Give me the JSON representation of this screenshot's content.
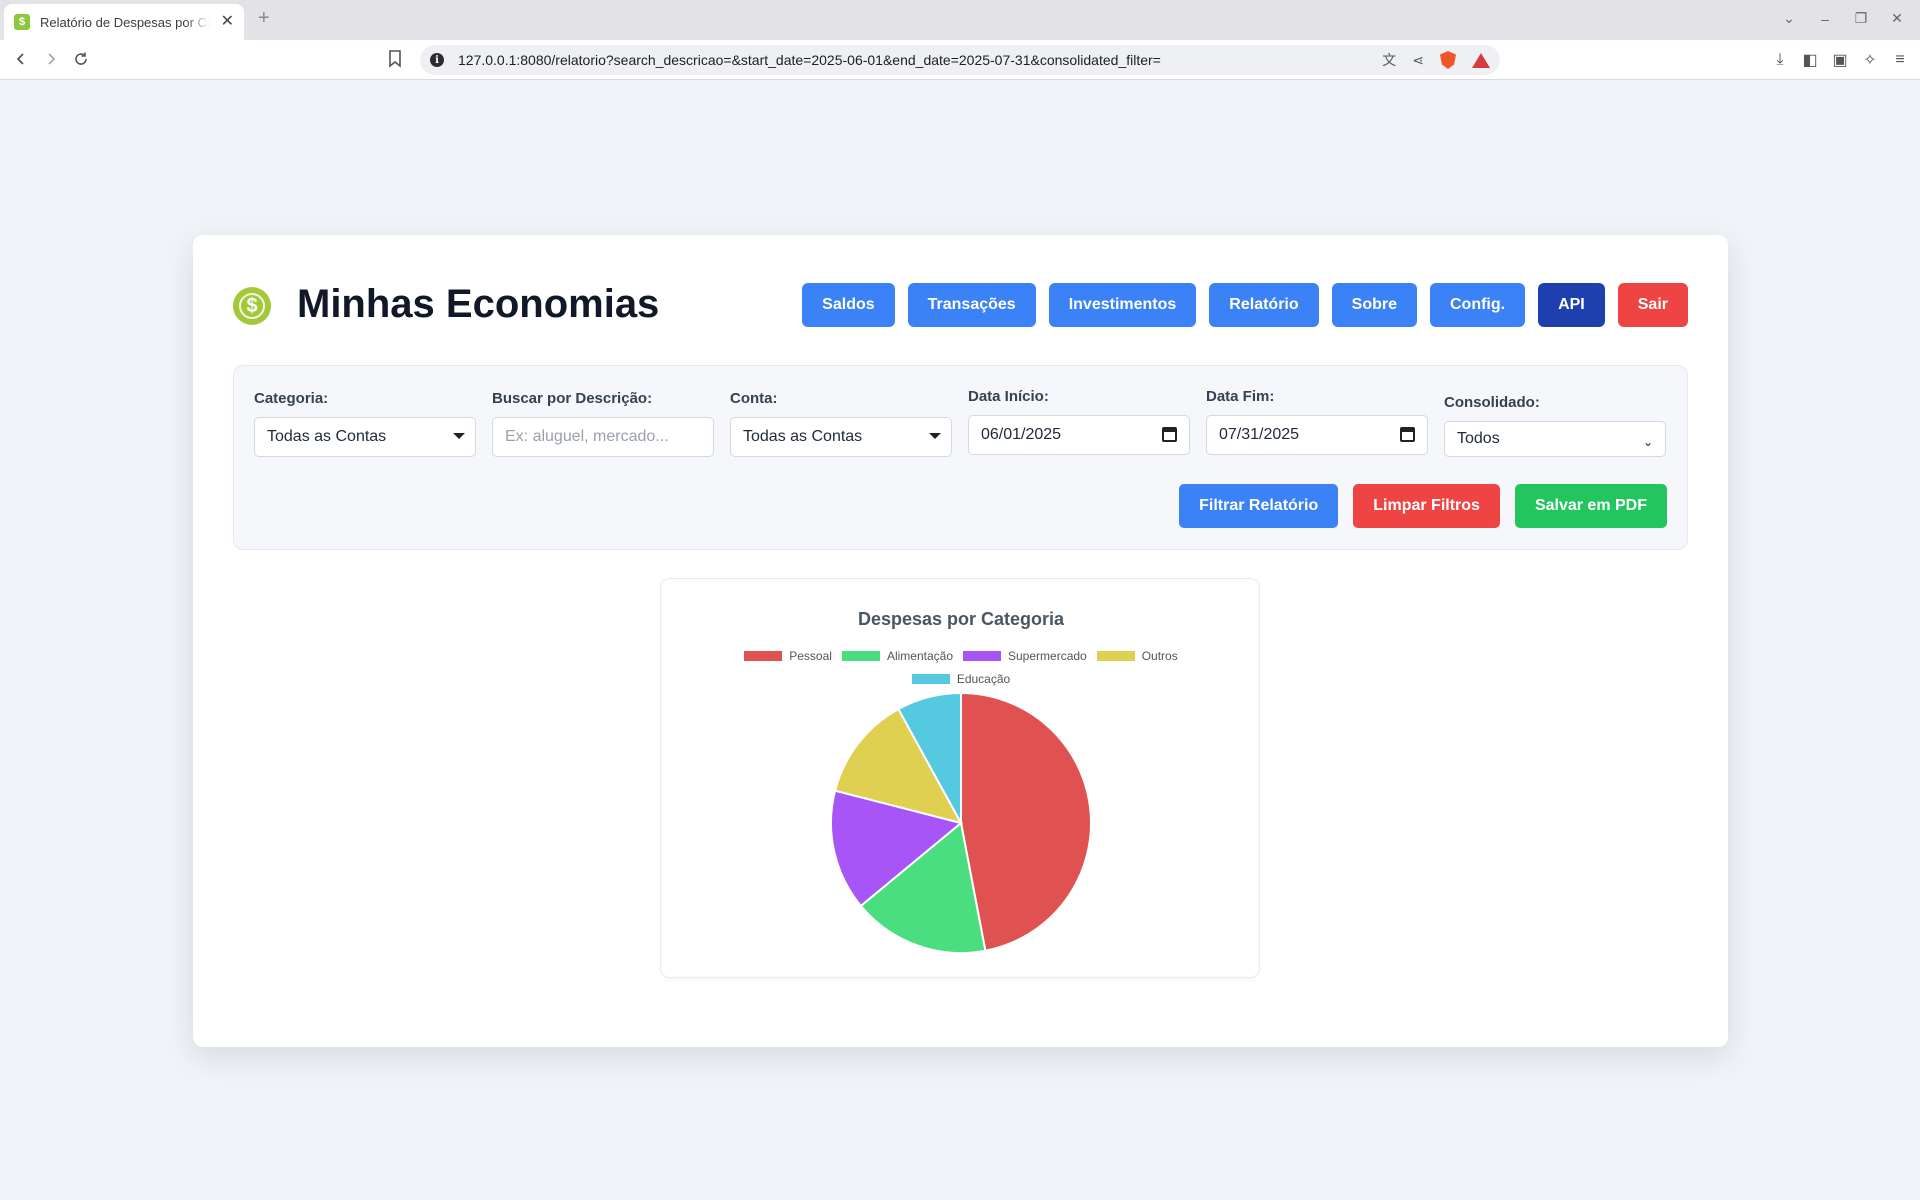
{
  "browser": {
    "tab_title": "Relatório de Despesas por Categoria",
    "url": "127.0.0.1:8080/relatorio?search_descricao=&start_date=2025-06-01&end_date=2025-07-31&consolidated_filter=",
    "close_glyph": "✕",
    "new_tab_glyph": "+"
  },
  "app": {
    "title": "Minhas Economias",
    "logo_glyph": "$"
  },
  "nav": {
    "items": [
      "Saldos",
      "Transações",
      "Investimentos",
      "Relatório",
      "Sobre",
      "Config.",
      "API",
      "Sair"
    ]
  },
  "filters": {
    "categoria": {
      "label": "Categoria:",
      "value": "Todas as Contas"
    },
    "descricao": {
      "label": "Buscar por Descrição:",
      "placeholder": "Ex: aluguel, mercado..."
    },
    "conta": {
      "label": "Conta:",
      "value": "Todas as Contas"
    },
    "data_inicio": {
      "label": "Data Início:",
      "value": "06/01/2025"
    },
    "data_fim": {
      "label": "Data Fim:",
      "value": "07/31/2025"
    },
    "consolidado": {
      "label": "Consolidado:",
      "value": "Todos"
    },
    "buttons": {
      "filtrar": "Filtrar Relatório",
      "limpar": "Limpar Filtros",
      "pdf": "Salvar em PDF"
    }
  },
  "colors": {
    "primary": "#3b82f6",
    "api": "#1e40af",
    "danger": "#ef4444",
    "success": "#22c55e"
  },
  "chart_data": {
    "type": "pie",
    "title": "Despesas por Categoria",
    "legend_position": "top",
    "categories": [
      "Pessoal",
      "Alimentação",
      "Supermercado",
      "Outros",
      "Educação"
    ],
    "values": [
      47,
      17,
      15,
      13,
      8
    ],
    "colors": [
      "#e05252",
      "#4ade80",
      "#a855f7",
      "#e0d052",
      "#55c9e0"
    ]
  }
}
